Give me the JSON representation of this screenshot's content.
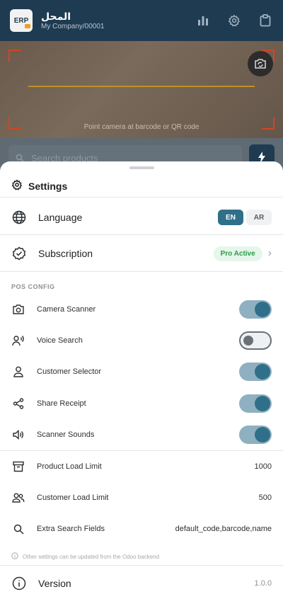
{
  "appbar": {
    "logo_text": "ERP",
    "store_name": "المحل",
    "company": "My Company/00001",
    "icons": [
      "bar-chart-icon",
      "gear-icon",
      "clipboard-icon"
    ]
  },
  "camera": {
    "hint": "Point camera at barcode or QR code"
  },
  "search": {
    "placeholder": "Search products"
  },
  "settings": {
    "title": "Settings",
    "language": {
      "label": "Language",
      "options": [
        "EN",
        "AR"
      ],
      "selected": "EN"
    },
    "subscription": {
      "label": "Subscription",
      "status": "Pro Active"
    },
    "section_label": "POS CONFIG",
    "toggles": [
      {
        "label": "Camera Scanner",
        "on": true
      },
      {
        "label": "Voice Search",
        "on": false
      },
      {
        "label": "Customer Selector",
        "on": true
      },
      {
        "label": "Share Receipt",
        "on": true
      },
      {
        "label": "Scanner Sounds",
        "on": true
      }
    ],
    "limits": [
      {
        "label": "Product Load Limit",
        "value": "1000"
      },
      {
        "label": "Customer Load Limit",
        "value": "500"
      },
      {
        "label": "Extra Search Fields",
        "value": "default_code,barcode,name"
      }
    ],
    "note": "Other settings can be updated from the Odoo backend",
    "version": {
      "label": "Version",
      "value": "1.0.0"
    }
  },
  "colors": {
    "primary": "#2f6f8a",
    "appbar": "#1f3b52",
    "badge_bg": "#e5f6ea",
    "badge_text": "#2e9a4a"
  }
}
